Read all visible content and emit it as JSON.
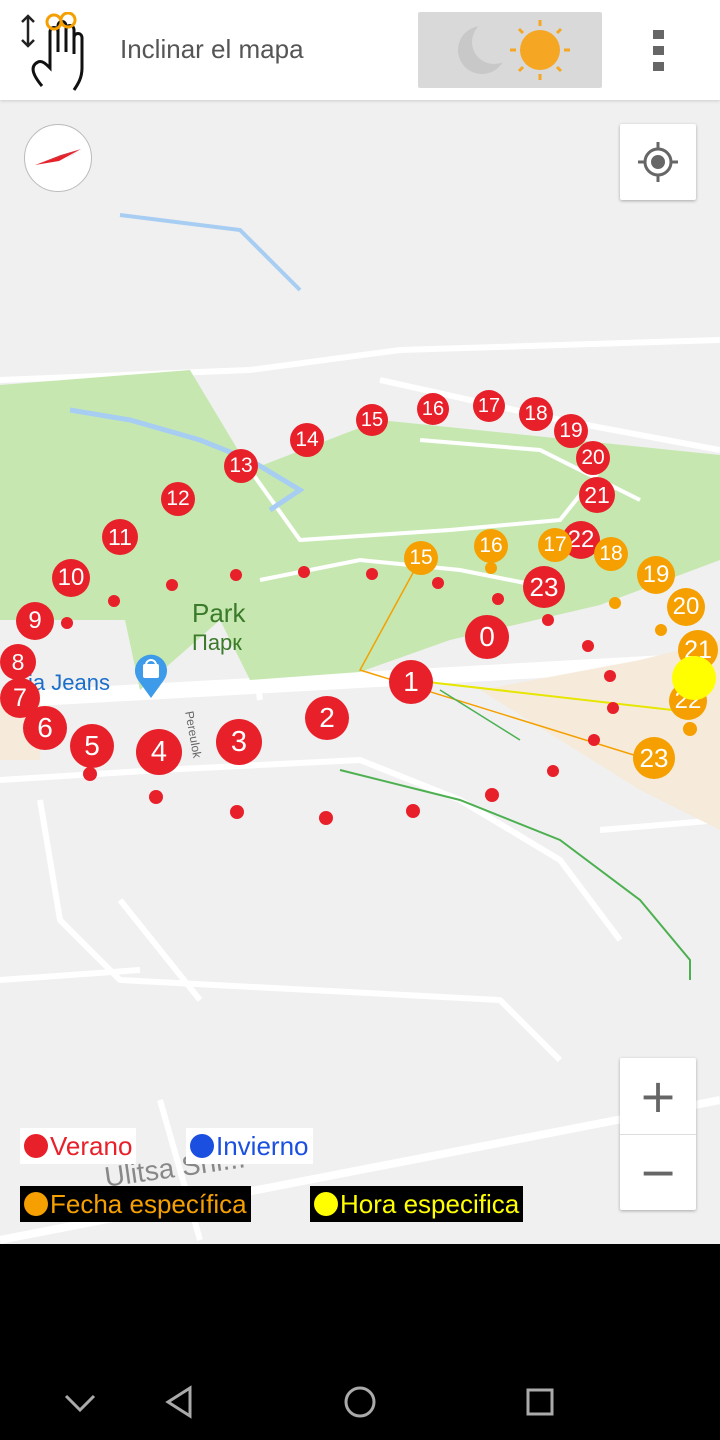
{
  "topbar": {
    "tilt_label": "Inclinar el mapa",
    "tilt_icon": "tilt-hand-icon",
    "mode_icons": [
      "moon-icon",
      "sun-icon"
    ],
    "menu_icon": "more-vert-icon"
  },
  "map": {
    "park_label": "Park",
    "park_label_ru": "Парк",
    "shop_label": "ia Jeans",
    "street_label": "Ulitsa Shi...",
    "street_vertical": "Pereulok",
    "compass_icon": "compass-icon",
    "locate_icon": "my-location-icon",
    "zoom_in_label": "+",
    "zoom_out_label": "−"
  },
  "sun_markers": {
    "summer": [
      "0",
      "1",
      "2",
      "3",
      "4",
      "5",
      "6",
      "7",
      "8",
      "9",
      "10",
      "11",
      "12",
      "13",
      "14",
      "15",
      "16",
      "17",
      "18",
      "19",
      "20",
      "21",
      "22",
      "23"
    ],
    "specific_date": [
      "15",
      "16",
      "17",
      "18",
      "19",
      "20",
      "21",
      "22",
      "23"
    ]
  },
  "legend": {
    "summer": "Verano",
    "winter": "Invierno",
    "specific_date": "Fecha específica",
    "specific_time": "Hora especifica",
    "colors": {
      "summer": "#e8202a",
      "winter": "#1a4fe0",
      "specific_date": "#f5a000",
      "specific_time": "#ffff00"
    }
  },
  "navbar": {
    "icons": [
      "back-icon",
      "home-icon",
      "recents-icon",
      "hide-keyboard-icon"
    ]
  }
}
